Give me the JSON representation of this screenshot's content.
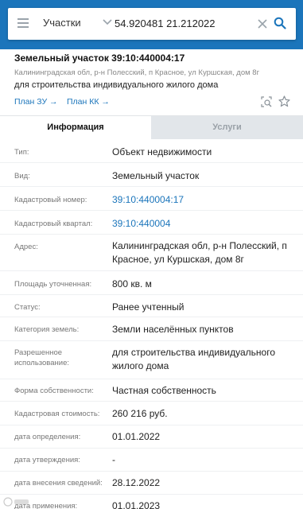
{
  "search": {
    "type_label": "Участки",
    "query": "54.920481 21.212022"
  },
  "object": {
    "title": "Земельный участок 39:10:440004:17",
    "address": "Калининградская обл, р-н Полесский, п Красное, ул Куршская, дом 8г",
    "purpose": "для строительства индивидуального жилого дома",
    "plan_zu": "План ЗУ →",
    "plan_kk": "План КК →"
  },
  "tabs": {
    "info": "Информация",
    "services": "Услуги"
  },
  "rows": [
    {
      "label": "Тип:",
      "value": "Объект недвижимости"
    },
    {
      "label": "Вид:",
      "value": "Земельный участок"
    },
    {
      "label": "Кадастровый номер:",
      "value": "39:10:440004:17"
    },
    {
      "label": "Кадастровый квартал:",
      "value": "39:10:440004"
    },
    {
      "label": "Адрес:",
      "value": "Калининградская обл, р-н Полесский, п Красное, ул Куршская, дом 8г"
    },
    {
      "label": "Площадь уточненная:",
      "value": "800 кв. м"
    },
    {
      "label": "Статус:",
      "value": "Ранее учтенный"
    },
    {
      "label": "Категория земель:",
      "value": "Земли населённых пунктов"
    },
    {
      "label": "Разрешенное использование:",
      "value": "для строительства индивидуального жилого дома"
    },
    {
      "label": "Форма собственности:",
      "value": "Частная собственность"
    },
    {
      "label": "Кадастровая стоимость:",
      "value": "260 216 руб."
    },
    {
      "label": "дата определения:",
      "value": "01.01.2022"
    },
    {
      "label": "дата утверждения:",
      "value": "-"
    },
    {
      "label": "дата внесения сведений:",
      "value": "28.12.2022"
    },
    {
      "label": "дата применения:",
      "value": "01.01.2023"
    }
  ],
  "icons": {
    "menu": "menu-icon",
    "chevron": "chevron-down-icon",
    "clear": "close-icon",
    "search": "search-icon",
    "zoom": "zoom-to-object-icon",
    "favorite": "star-icon"
  },
  "colors": {
    "brand": "#1b75bb",
    "link": "#1b75bb",
    "tab_inactive": "#e2e6ea"
  }
}
